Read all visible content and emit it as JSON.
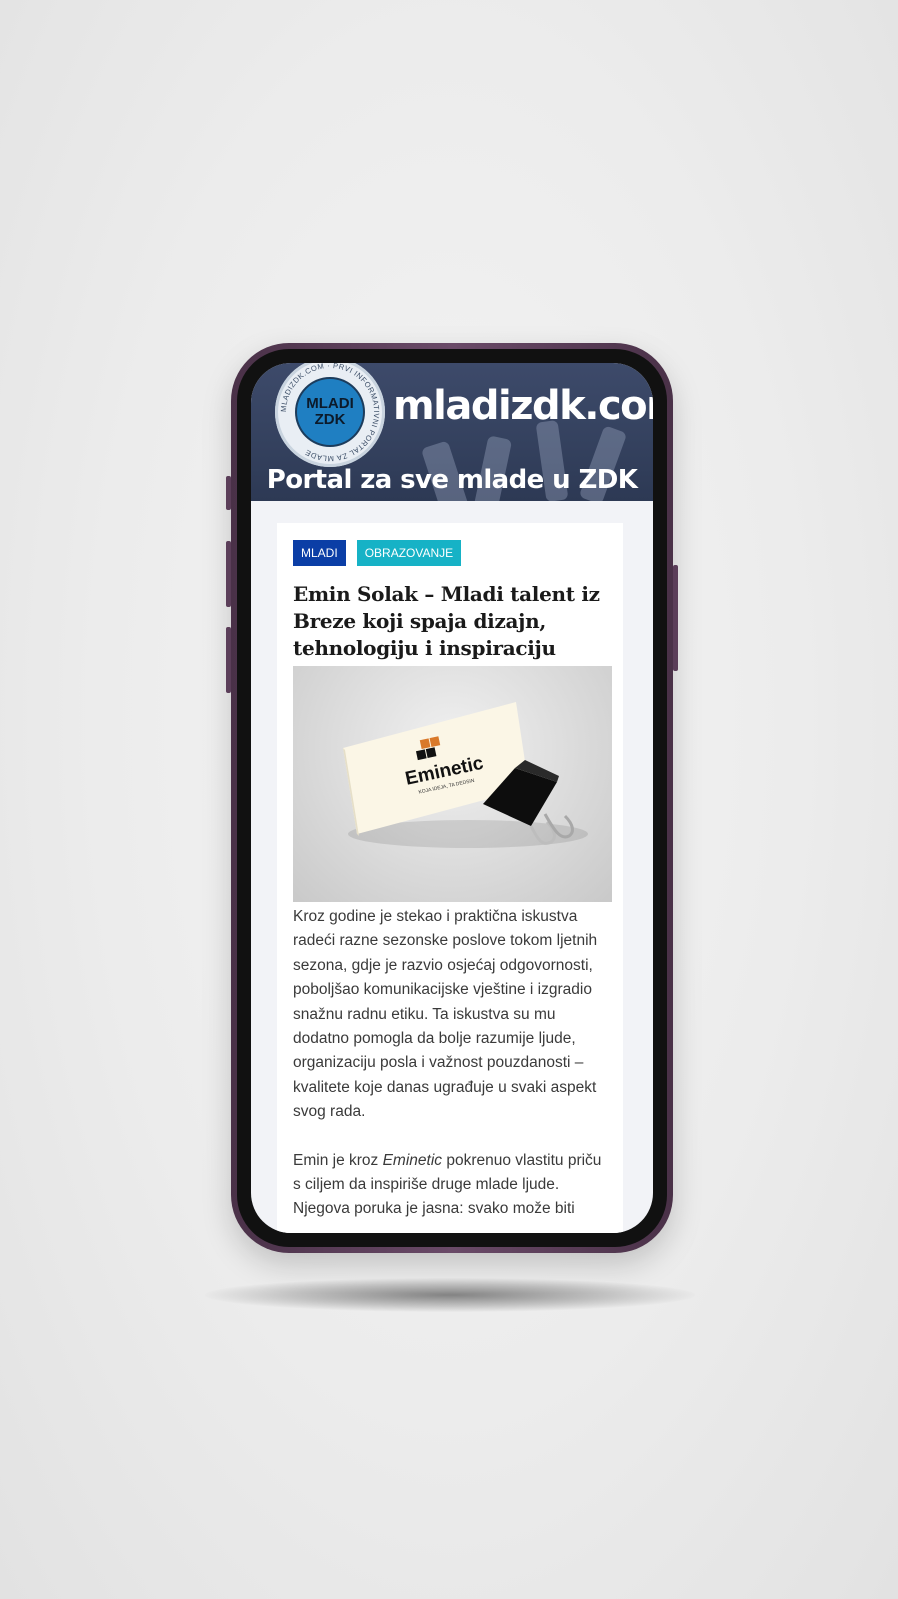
{
  "header": {
    "logo_text": "MLADI\nZDK",
    "logo_ring_text": "MLADIZDK.COM · PRVI INFORMATIVNI PORTAL ZA MLADE",
    "site_name": "mladizdk.com",
    "tagline": "Portal za sve mlade u ZDK"
  },
  "categories": [
    "MLADI",
    "OBRAZOVANJE"
  ],
  "article": {
    "title": "Emin Solak – Mladi talent iz Breze koji spaja dizajn, tehnologiju i inspiraciju",
    "image": {
      "brand_name": "Eminetic",
      "brand_slogan": "KOJA IDEJA, TA DEDSIN"
    },
    "paragraph1": "Kroz godine je stekao i praktična iskustva radeći razne sezonske poslove tokom ljetnih sezona, gdje je razvio osjećaj odgovornosti, poboljšao komunikacijske vještine i izgradio snažnu radnu etiku. Ta iskustva su mu dodatno pomogla da bolje razumije ljude, organizaciju posla i važnost pouzdanosti – kvalitete koje danas ugrađuje u svaki aspekt svog rada.",
    "paragraph2": {
      "before": "Emin je kroz ",
      "emphasis": "Eminetic",
      "after": " pokrenuo vlastitu priču s ciljem da inspiriše druge mlade ljude. Njegova poruka je jasna: svako može biti"
    }
  },
  "colors": {
    "banner": "#34415e",
    "mladi_tag": "#0b3ea6",
    "obrazovanje_tag": "#16b2c6",
    "phone_frame": "#5b3e59"
  }
}
